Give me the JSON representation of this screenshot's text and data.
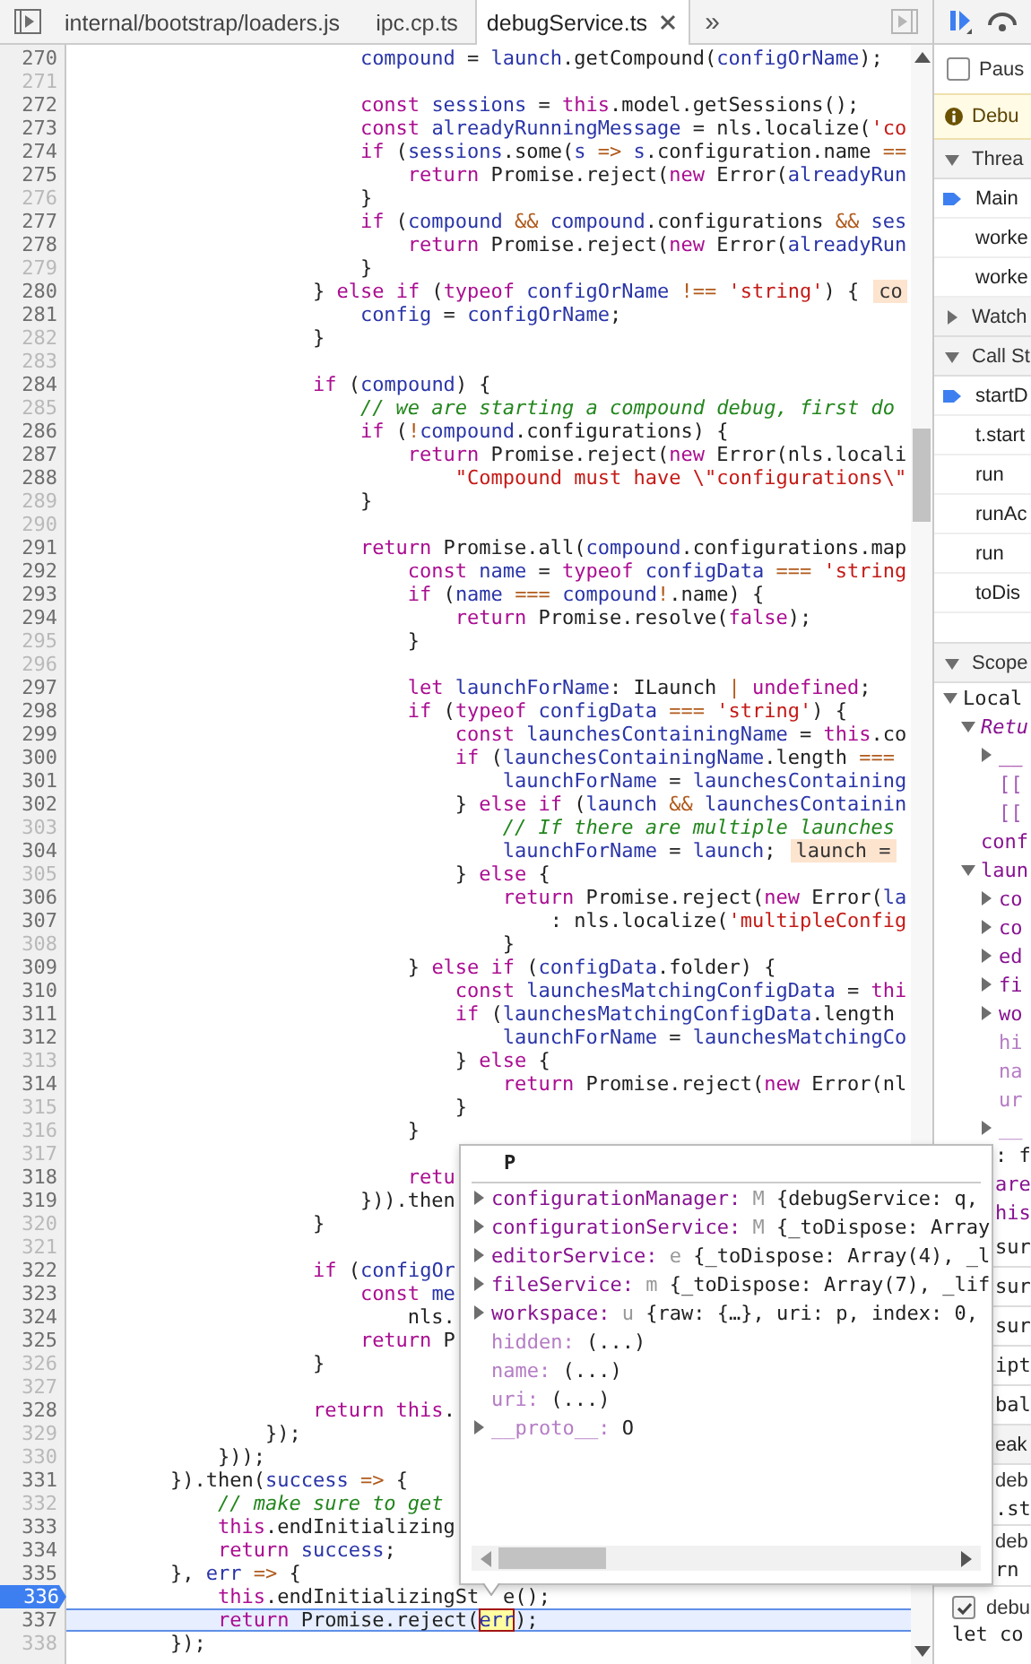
{
  "tabs": [
    {
      "label": "internal/bootstrap/loaders.js",
      "selected": false
    },
    {
      "label": "ipc.cp.ts",
      "selected": false
    },
    {
      "label": "debugService.ts",
      "selected": true
    }
  ],
  "tab_overflow": "»",
  "editor": {
    "lines": [
      {
        "number": "270",
        "breakable": true,
        "breakpoint": false,
        "paused": false,
        "tokens": [
          {
            "kind": "name",
            "text": "                        compound"
          },
          " = ",
          {
            "kind": "name",
            "text": "launch"
          },
          ".getCompound(",
          {
            "kind": "name",
            "text": "configOrName"
          },
          ");"
        ]
      },
      {
        "number": "271",
        "breakable": false,
        "breakpoint": false,
        "paused": false
      },
      {
        "number": "272",
        "breakable": true,
        "breakpoint": false,
        "paused": false,
        "tokens": [
          {
            "kind": "keyword",
            "text": "                        const "
          },
          {
            "kind": "name",
            "text": "sessions"
          },
          " = ",
          {
            "kind": "keyword",
            "text": "this"
          },
          ".model.getSessions();"
        ]
      },
      {
        "number": "273",
        "breakable": true,
        "breakpoint": false,
        "paused": false,
        "tokens": [
          {
            "kind": "keyword",
            "text": "                        const "
          },
          {
            "kind": "name",
            "text": "alreadyRunningMessage"
          },
          " = nls.localize(",
          {
            "kind": "string",
            "text": "'co"
          }
        ]
      },
      {
        "number": "274",
        "breakable": true,
        "breakpoint": false,
        "paused": false,
        "tokens": [
          {
            "kind": "keyword",
            "text": "                        if"
          },
          " (",
          {
            "kind": "name",
            "text": "sessions"
          },
          ".some(",
          {
            "kind": "name",
            "text": "s "
          },
          {
            "kind": "operator",
            "text": "=> "
          },
          {
            "kind": "name",
            "text": "s"
          },
          ".configuration.name ",
          {
            "kind": "operator",
            "text": "=="
          }
        ]
      },
      {
        "number": "275",
        "breakable": true,
        "breakpoint": false,
        "paused": false,
        "tokens": [
          {
            "kind": "keyword",
            "text": "                            return"
          },
          " Promise.reject(",
          {
            "kind": "keyword",
            "text": "new"
          },
          " Error(",
          {
            "kind": "name",
            "text": "alreadyRun"
          }
        ]
      },
      {
        "number": "276",
        "breakable": false,
        "breakpoint": false,
        "paused": false,
        "tokens": [
          "                        }"
        ]
      },
      {
        "number": "277",
        "breakable": true,
        "breakpoint": false,
        "paused": false,
        "tokens": [
          {
            "kind": "keyword",
            "text": "                        if"
          },
          " (",
          {
            "kind": "name",
            "text": "compound "
          },
          {
            "kind": "operator",
            "text": "&& "
          },
          {
            "kind": "name",
            "text": "compound"
          },
          ".configurations ",
          {
            "kind": "operator",
            "text": "&& "
          },
          {
            "kind": "name",
            "text": "ses"
          }
        ]
      },
      {
        "number": "278",
        "breakable": true,
        "breakpoint": false,
        "paused": false,
        "tokens": [
          {
            "kind": "keyword",
            "text": "                            return"
          },
          " Promise.reject(",
          {
            "kind": "keyword",
            "text": "new"
          },
          " Error(",
          {
            "kind": "name",
            "text": "alreadyRun"
          }
        ]
      },
      {
        "number": "279",
        "breakable": false,
        "breakpoint": false,
        "paused": false,
        "tokens": [
          "                        }"
        ]
      },
      {
        "number": "280",
        "breakable": true,
        "breakpoint": false,
        "paused": false,
        "hint": "co",
        "tokens": [
          "                    } ",
          {
            "kind": "keyword",
            "text": "else if"
          },
          " (",
          {
            "kind": "keyword",
            "text": "typeof "
          },
          {
            "kind": "name",
            "text": "configOrName "
          },
          {
            "kind": "operator",
            "text": "!== "
          },
          {
            "kind": "string",
            "text": "'string'"
          },
          ") {"
        ]
      },
      {
        "number": "281",
        "breakable": true,
        "breakpoint": false,
        "paused": false,
        "tokens": [
          {
            "kind": "name",
            "text": "                        config"
          },
          " = ",
          {
            "kind": "name",
            "text": "configOrName"
          },
          ";"
        ]
      },
      {
        "number": "282",
        "breakable": false,
        "breakpoint": false,
        "paused": false,
        "tokens": [
          "                    }"
        ]
      },
      {
        "number": "283",
        "breakable": false,
        "breakpoint": false,
        "paused": false
      },
      {
        "number": "284",
        "breakable": true,
        "breakpoint": false,
        "paused": false,
        "tokens": [
          {
            "kind": "keyword",
            "text": "                    if"
          },
          " (",
          {
            "kind": "name",
            "text": "compound"
          },
          ") {"
        ]
      },
      {
        "number": "285",
        "breakable": false,
        "breakpoint": false,
        "paused": false,
        "tokens": [
          {
            "kind": "comment",
            "text": "                        // we are starting a compound debug, first do"
          }
        ]
      },
      {
        "number": "286",
        "breakable": true,
        "breakpoint": false,
        "paused": false,
        "tokens": [
          {
            "kind": "keyword",
            "text": "                        if"
          },
          " (",
          {
            "kind": "operator",
            "text": "!"
          },
          {
            "kind": "name",
            "text": "compound"
          },
          ".configurations) {"
        ]
      },
      {
        "number": "287",
        "breakable": true,
        "breakpoint": false,
        "paused": false,
        "tokens": [
          {
            "kind": "keyword",
            "text": "                            return"
          },
          " Promise.reject(",
          {
            "kind": "keyword",
            "text": "new"
          },
          " Error(nls.locali"
        ]
      },
      {
        "number": "288",
        "breakable": true,
        "breakpoint": false,
        "paused": false,
        "tokens": [
          {
            "kind": "string",
            "text": "                                \"Compound must have \\\"configurations\\\""
          }
        ]
      },
      {
        "number": "289",
        "breakable": false,
        "breakpoint": false,
        "paused": false,
        "tokens": [
          "                        }"
        ]
      },
      {
        "number": "290",
        "breakable": false,
        "breakpoint": false,
        "paused": false
      },
      {
        "number": "291",
        "breakable": true,
        "breakpoint": false,
        "paused": false,
        "tokens": [
          {
            "kind": "keyword",
            "text": "                        return"
          },
          " Promise.all(",
          {
            "kind": "name",
            "text": "compound"
          },
          ".configurations.map"
        ]
      },
      {
        "number": "292",
        "breakable": true,
        "breakpoint": false,
        "paused": false,
        "tokens": [
          {
            "kind": "keyword",
            "text": "                            const "
          },
          {
            "kind": "name",
            "text": "name"
          },
          " = ",
          {
            "kind": "keyword",
            "text": "typeof "
          },
          {
            "kind": "name",
            "text": "configData "
          },
          {
            "kind": "operator",
            "text": "=== "
          },
          {
            "kind": "string",
            "text": "'string"
          }
        ]
      },
      {
        "number": "293",
        "breakable": true,
        "breakpoint": false,
        "paused": false,
        "tokens": [
          {
            "kind": "keyword",
            "text": "                            if"
          },
          " (",
          {
            "kind": "name",
            "text": "name "
          },
          {
            "kind": "operator",
            "text": "=== "
          },
          {
            "kind": "name",
            "text": "compound"
          },
          {
            "kind": "operator",
            "text": "!"
          },
          ".name) {"
        ]
      },
      {
        "number": "294",
        "breakable": true,
        "breakpoint": false,
        "paused": false,
        "tokens": [
          {
            "kind": "keyword",
            "text": "                                return"
          },
          " Promise.resolve(",
          {
            "kind": "keyword",
            "text": "false"
          },
          ");"
        ]
      },
      {
        "number": "295",
        "breakable": false,
        "breakpoint": false,
        "paused": false,
        "tokens": [
          "                            }"
        ]
      },
      {
        "number": "296",
        "breakable": false,
        "breakpoint": false,
        "paused": false
      },
      {
        "number": "297",
        "breakable": true,
        "breakpoint": false,
        "paused": false,
        "tokens": [
          {
            "kind": "keyword",
            "text": "                            let "
          },
          {
            "kind": "name",
            "text": "launchForName"
          },
          ": ILaunch ",
          {
            "kind": "operator",
            "text": "| "
          },
          {
            "kind": "keyword",
            "text": "undefined"
          },
          ";"
        ]
      },
      {
        "number": "298",
        "breakable": true,
        "breakpoint": false,
        "paused": false,
        "tokens": [
          {
            "kind": "keyword",
            "text": "                            if"
          },
          " (",
          {
            "kind": "keyword",
            "text": "typeof "
          },
          {
            "kind": "name",
            "text": "configData "
          },
          {
            "kind": "operator",
            "text": "=== "
          },
          {
            "kind": "string",
            "text": "'string'"
          },
          ") {"
        ]
      },
      {
        "number": "299",
        "breakable": true,
        "breakpoint": false,
        "paused": false,
        "tokens": [
          {
            "kind": "keyword",
            "text": "                                const "
          },
          {
            "kind": "name",
            "text": "launchesContainingName"
          },
          " = ",
          {
            "kind": "keyword",
            "text": "this"
          },
          ".co"
        ]
      },
      {
        "number": "300",
        "breakable": true,
        "breakpoint": false,
        "paused": false,
        "tokens": [
          {
            "kind": "keyword",
            "text": "                                if"
          },
          " (",
          {
            "kind": "name",
            "text": "launchesContainingName"
          },
          ".length ",
          {
            "kind": "operator",
            "text": "==="
          }
        ]
      },
      {
        "number": "301",
        "breakable": true,
        "breakpoint": false,
        "paused": false,
        "tokens": [
          {
            "kind": "name",
            "text": "                                    launchForName"
          },
          " = ",
          {
            "kind": "name",
            "text": "launchesContaining"
          }
        ]
      },
      {
        "number": "302",
        "breakable": true,
        "breakpoint": false,
        "paused": false,
        "tokens": [
          "                                } ",
          {
            "kind": "keyword",
            "text": "else if"
          },
          " (",
          {
            "kind": "name",
            "text": "launch "
          },
          {
            "kind": "operator",
            "text": "&& "
          },
          {
            "kind": "name",
            "text": "launchesContainin"
          }
        ]
      },
      {
        "number": "303",
        "breakable": false,
        "breakpoint": false,
        "paused": false,
        "tokens": [
          {
            "kind": "comment",
            "text": "                                    // If there are multiple launches"
          }
        ]
      },
      {
        "number": "304",
        "breakable": true,
        "breakpoint": false,
        "paused": false,
        "hint": "launch =",
        "tokens": [
          {
            "kind": "name",
            "text": "                                    launchForName"
          },
          " = ",
          {
            "kind": "name",
            "text": "launch"
          },
          ";"
        ]
      },
      {
        "number": "305",
        "breakable": false,
        "breakpoint": false,
        "paused": false,
        "tokens": [
          "                                } ",
          {
            "kind": "keyword",
            "text": "else"
          },
          " {"
        ]
      },
      {
        "number": "306",
        "breakable": true,
        "breakpoint": false,
        "paused": false,
        "tokens": [
          {
            "kind": "keyword",
            "text": "                                    return"
          },
          " Promise.reject(",
          {
            "kind": "keyword",
            "text": "new"
          },
          " Error(",
          {
            "kind": "name",
            "text": "la"
          }
        ]
      },
      {
        "number": "307",
        "breakable": true,
        "breakpoint": false,
        "paused": false,
        "tokens": [
          "                                        : nls.localize(",
          {
            "kind": "string",
            "text": "'multipleConfig"
          }
        ]
      },
      {
        "number": "308",
        "breakable": false,
        "breakpoint": false,
        "paused": false,
        "tokens": [
          "                                    }"
        ]
      },
      {
        "number": "309",
        "breakable": true,
        "breakpoint": false,
        "paused": false,
        "tokens": [
          "                            } ",
          {
            "kind": "keyword",
            "text": "else if"
          },
          " (",
          {
            "kind": "name",
            "text": "configData"
          },
          ".folder) {"
        ]
      },
      {
        "number": "310",
        "breakable": true,
        "breakpoint": false,
        "paused": false,
        "tokens": [
          {
            "kind": "keyword",
            "text": "                                const "
          },
          {
            "kind": "name",
            "text": "launchesMatchingConfigData"
          },
          " = ",
          {
            "kind": "keyword",
            "text": "thi"
          }
        ]
      },
      {
        "number": "311",
        "breakable": true,
        "breakpoint": false,
        "paused": false,
        "tokens": [
          {
            "kind": "keyword",
            "text": "                                if"
          },
          " (",
          {
            "kind": "name",
            "text": "launchesMatchingConfigData"
          },
          ".length"
        ]
      },
      {
        "number": "312",
        "breakable": true,
        "breakpoint": false,
        "paused": false,
        "tokens": [
          {
            "kind": "name",
            "text": "                                    launchForName"
          },
          " = ",
          {
            "kind": "name",
            "text": "launchesMatchingCo"
          }
        ]
      },
      {
        "number": "313",
        "breakable": false,
        "breakpoint": false,
        "paused": false,
        "tokens": [
          "                                } ",
          {
            "kind": "keyword",
            "text": "else"
          },
          " {"
        ]
      },
      {
        "number": "314",
        "breakable": true,
        "breakpoint": false,
        "paused": false,
        "tokens": [
          {
            "kind": "keyword",
            "text": "                                    return"
          },
          " Promise.reject(",
          {
            "kind": "keyword",
            "text": "new"
          },
          " Error(nl"
        ]
      },
      {
        "number": "315",
        "breakable": false,
        "breakpoint": false,
        "paused": false,
        "tokens": [
          "                                }"
        ]
      },
      {
        "number": "316",
        "breakable": false,
        "breakpoint": false,
        "paused": false,
        "tokens": [
          "                            }"
        ]
      },
      {
        "number": "317",
        "breakable": false,
        "breakpoint": false,
        "paused": false
      },
      {
        "number": "318",
        "breakable": true,
        "breakpoint": false,
        "paused": false,
        "tokens": [
          {
            "kind": "keyword",
            "text": "                            retu"
          }
        ]
      },
      {
        "number": "319",
        "breakable": true,
        "breakpoint": false,
        "paused": false,
        "tokens": [
          "                        })).then"
        ]
      },
      {
        "number": "320",
        "breakable": false,
        "breakpoint": false,
        "paused": false,
        "tokens": [
          "                    }"
        ]
      },
      {
        "number": "321",
        "breakable": false,
        "breakpoint": false,
        "paused": false
      },
      {
        "number": "322",
        "breakable": true,
        "breakpoint": false,
        "paused": false,
        "tokens": [
          {
            "kind": "keyword",
            "text": "                    if"
          },
          " (",
          {
            "kind": "name",
            "text": "configOr"
          }
        ]
      },
      {
        "number": "323",
        "breakable": true,
        "breakpoint": false,
        "paused": false,
        "tokens": [
          {
            "kind": "keyword",
            "text": "                        const "
          },
          {
            "kind": "name",
            "text": "me"
          }
        ]
      },
      {
        "number": "324",
        "breakable": true,
        "breakpoint": false,
        "paused": false,
        "tokens": [
          "                            nls."
        ]
      },
      {
        "number": "325",
        "breakable": true,
        "breakpoint": false,
        "paused": false,
        "tokens": [
          {
            "kind": "keyword",
            "text": "                        return"
          },
          " P"
        ]
      },
      {
        "number": "326",
        "breakable": false,
        "breakpoint": false,
        "paused": false,
        "tokens": [
          "                    }"
        ]
      },
      {
        "number": "327",
        "breakable": false,
        "breakpoint": false,
        "paused": false
      },
      {
        "number": "328",
        "breakable": true,
        "breakpoint": false,
        "paused": false,
        "tokens": [
          {
            "kind": "keyword",
            "text": "                    return this"
          },
          "."
        ]
      },
      {
        "number": "329",
        "breakable": false,
        "breakpoint": false,
        "paused": false,
        "tokens": [
          "                });"
        ]
      },
      {
        "number": "330",
        "breakable": false,
        "breakpoint": false,
        "paused": false,
        "tokens": [
          "            }));"
        ]
      },
      {
        "number": "331",
        "breakable": true,
        "breakpoint": false,
        "paused": false,
        "tokens": [
          "        }).then(",
          {
            "kind": "name",
            "text": "success "
          },
          {
            "kind": "operator",
            "text": "=>"
          },
          " {"
        ]
      },
      {
        "number": "332",
        "breakable": false,
        "breakpoint": false,
        "paused": false,
        "tokens": [
          {
            "kind": "comment",
            "text": "            // make sure to get"
          }
        ]
      },
      {
        "number": "333",
        "breakable": true,
        "breakpoint": false,
        "paused": false,
        "tokens": [
          {
            "kind": "keyword",
            "text": "            this"
          },
          ".endInitializing"
        ]
      },
      {
        "number": "334",
        "breakable": true,
        "breakpoint": false,
        "paused": false,
        "tokens": [
          {
            "kind": "keyword",
            "text": "            return "
          },
          {
            "kind": "name",
            "text": "success"
          },
          ";"
        ]
      },
      {
        "number": "335",
        "breakable": true,
        "breakpoint": false,
        "paused": false,
        "tokens": [
          "        }, ",
          {
            "kind": "name",
            "text": "err "
          },
          {
            "kind": "operator",
            "text": "=>"
          },
          " {"
        ]
      },
      {
        "number": "336",
        "breakable": true,
        "breakpoint": true,
        "paused": false,
        "tokens": [
          {
            "kind": "keyword",
            "text": "            this"
          },
          ".endInitializingSt"
        ],
        "tail": "e();"
      },
      {
        "number": "337",
        "breakable": true,
        "breakpoint": false,
        "paused": true,
        "tokens": [
          {
            "kind": "keyword",
            "text": "            return"
          },
          " Promise.reject(",
          {
            "kind": "hovered",
            "text": "err"
          },
          ");"
        ]
      },
      {
        "number": "338",
        "breakable": false,
        "breakpoint": false,
        "paused": false,
        "tokens": [
          "        });"
        ]
      }
    ]
  },
  "popover": {
    "title": "P",
    "rows": [
      {
        "expandable": true,
        "dimmed": false,
        "key": "configurationManager:",
        "type": "M",
        "value": "{debugService: q,"
      },
      {
        "expandable": true,
        "dimmed": false,
        "key": "configurationService:",
        "type": "M",
        "value": "{_toDispose: Array"
      },
      {
        "expandable": true,
        "dimmed": false,
        "key": "editorService:",
        "type": "e",
        "value": "{_toDispose: Array(4), _l"
      },
      {
        "expandable": true,
        "dimmed": false,
        "key": "fileService:",
        "type": "m",
        "value": "{_toDispose: Array(7), _lif"
      },
      {
        "expandable": true,
        "dimmed": false,
        "key": "workspace:",
        "type": "u",
        "value": "{raw: {…}, uri: p, index: 0,"
      },
      {
        "expandable": false,
        "dimmed": true,
        "key": "hidden:",
        "value": "(...)"
      },
      {
        "expandable": false,
        "dimmed": true,
        "key": "name:",
        "value": "(...)"
      },
      {
        "expandable": false,
        "dimmed": true,
        "key": "uri:",
        "value": "(...)"
      },
      {
        "expandable": true,
        "dimmed": true,
        "key": "__proto__:",
        "value": "O"
      }
    ]
  },
  "sidebar": {
    "pause_option": {
      "label": "Paus",
      "checked": false
    },
    "banner": {
      "text": "Debu"
    },
    "threads": {
      "title": "Threa",
      "expanded": true,
      "items": [
        {
          "label": "Main",
          "selected": true
        },
        {
          "label": "worke",
          "selected": false
        },
        {
          "label": "worke",
          "selected": false
        }
      ]
    },
    "watch": {
      "title": "Watch",
      "expanded": false
    },
    "call_stack": {
      "title": "Call St",
      "expanded": true,
      "items": [
        {
          "label": "startD",
          "selected": true
        },
        {
          "label": "t.start",
          "selected": false
        },
        {
          "label": "run",
          "selected": false
        },
        {
          "label": "runAc",
          "selected": false
        },
        {
          "label": "run",
          "selected": false
        },
        {
          "label": "toDis",
          "selected": false
        }
      ]
    },
    "scope": {
      "title": "Scope",
      "expanded": true,
      "tree": [
        {
          "label": "Local",
          "kind": "scope",
          "expanded": true,
          "children": [
            {
              "label": "Retu",
              "kind": "special",
              "expanded": true,
              "children": [
                {
                  "label": "__",
                  "kind": "property",
                  "expanded": false
                },
                {
                  "label": "[[",
                  "kind": "internal"
                },
                {
                  "label": "[[",
                  "kind": "internal"
                }
              ]
            },
            {
              "label": "conf",
              "kind": "property"
            },
            {
              "label": "laun",
              "kind": "property",
              "expanded": true,
              "children": [
                {
                  "label": "co",
                  "kind": "property",
                  "expanded": false
                },
                {
                  "label": "co",
                  "kind": "property",
                  "expanded": false
                },
                {
                  "label": "ed",
                  "kind": "property",
                  "expanded": false
                },
                {
                  "label": "fi",
                  "kind": "property",
                  "expanded": false
                },
                {
                  "label": "wo",
                  "kind": "property",
                  "expanded": false
                },
                {
                  "label": "hi",
                  "kind": "accessor"
                },
                {
                  "label": "na",
                  "kind": "accessor"
                },
                {
                  "label": "ur",
                  "kind": "accessor"
                },
                {
                  "label": "__",
                  "kind": "accessor",
                  "expanded": false
                }
              ]
            }
          ]
        }
      ],
      "covered_rows": [
        {
          "kind": "value",
          "text": ": f"
        },
        {
          "kind": "property",
          "text": "are"
        },
        {
          "kind": "property",
          "text": "his"
        },
        {
          "kind": "scope",
          "text": "sur"
        },
        {
          "kind": "scope",
          "text": "sur"
        },
        {
          "kind": "scope",
          "text": "sur"
        },
        {
          "kind": "scope",
          "text": "ipt"
        },
        {
          "kind": "scope",
          "text": "bal"
        }
      ]
    },
    "breakpoints": {
      "title": "eak",
      "items": [
        {
          "kind": "partial",
          "file": "deb",
          "code": ".st"
        },
        {
          "kind": "partial",
          "file": "deb",
          "code": "rn"
        },
        {
          "kind": "full",
          "file": "debu",
          "code": "let co",
          "checked": true
        }
      ]
    }
  }
}
